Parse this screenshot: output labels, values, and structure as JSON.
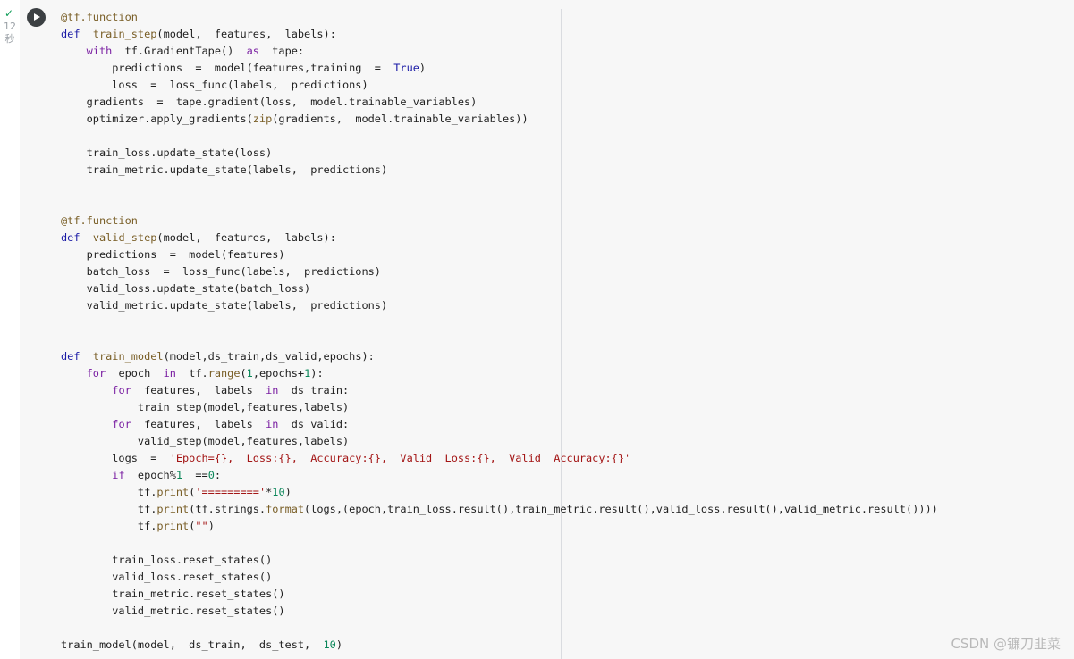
{
  "cell": {
    "status_icon": "check-icon",
    "status_check": "✓",
    "exec_time": "12",
    "exec_unit": "秒",
    "run_icon": "play-icon"
  },
  "code_lines": [
    "@tf.function",
    "def  train_step(model,  features,  labels):",
    "    with  tf.GradientTape()  as  tape:",
    "        predictions  =  model(features,training  =  True)",
    "        loss  =  loss_func(labels,  predictions)",
    "    gradients  =  tape.gradient(loss,  model.trainable_variables)",
    "    optimizer.apply_gradients(zip(gradients,  model.trainable_variables))",
    "",
    "    train_loss.update_state(loss)",
    "    train_metric.update_state(labels,  predictions)",
    "",
    "",
    "@tf.function",
    "def  valid_step(model,  features,  labels):",
    "    predictions  =  model(features)",
    "    batch_loss  =  loss_func(labels,  predictions)",
    "    valid_loss.update_state(batch_loss)",
    "    valid_metric.update_state(labels,  predictions)",
    "",
    "",
    "def  train_model(model,ds_train,ds_valid,epochs):",
    "    for  epoch  in  tf.range(1,epochs+1):",
    "        for  features,  labels  in  ds_train:",
    "            train_step(model,features,labels)",
    "        for  features,  labels  in  ds_valid:",
    "            valid_step(model,features,labels)",
    "        logs  =  'Epoch={},  Loss:{},  Accuracy:{},  Valid  Loss:{},  Valid  Accuracy:{}'",
    "        if  epoch%1  ==0:",
    "            tf.print('========='*10)",
    "            tf.print(tf.strings.format(logs,(epoch,train_loss.result(),train_metric.result(),valid_loss.result(),valid_metric.result())))",
    "            tf.print(\"\")",
    "",
    "        train_loss.reset_states()",
    "        valid_loss.reset_states()",
    "        train_metric.reset_states()",
    "        valid_metric.reset_states()",
    "",
    "train_model(model,  ds_train,  ds_test,  10)"
  ],
  "watermark": "CSDN @镰刀韭菜",
  "colors": {
    "keyword": "#7a1fa2",
    "def": "#1a1aa6",
    "decorator": "#795e26",
    "number": "#098658",
    "string": "#a31515",
    "cell_bg": "#f7f7f7"
  }
}
